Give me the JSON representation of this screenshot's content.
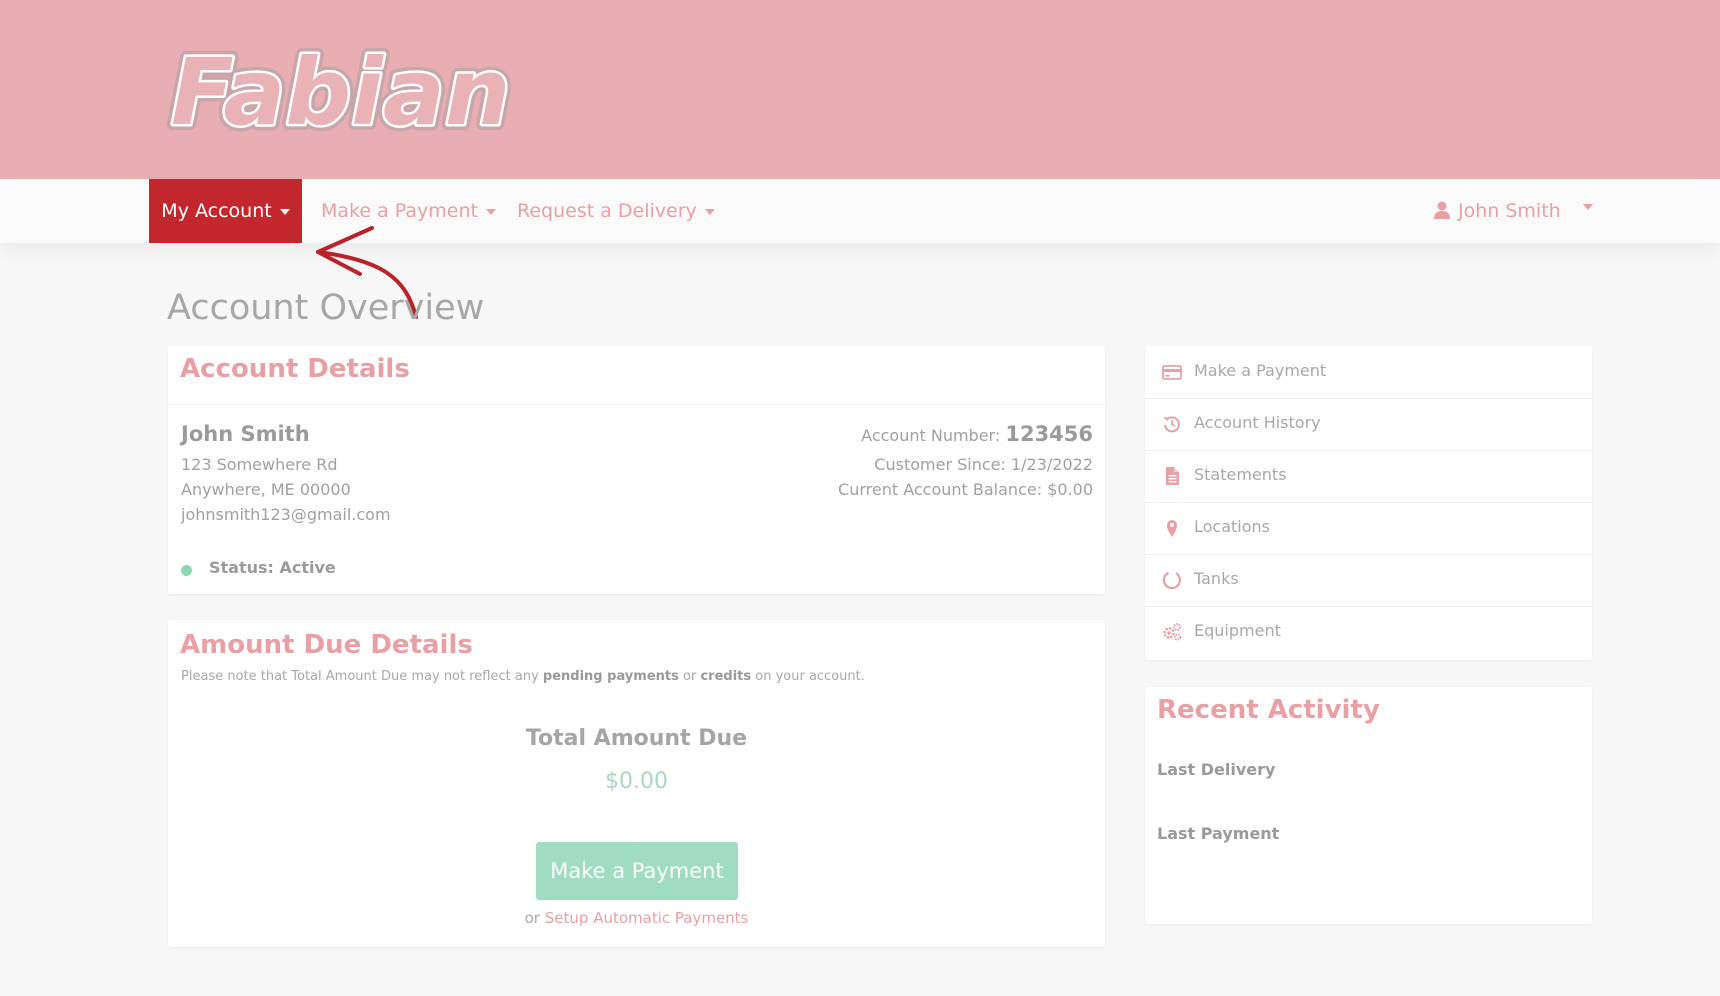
{
  "brand": {
    "logo_text": "Fabian"
  },
  "nav": {
    "my_account": "My Account",
    "make_payment": "Make a Payment",
    "request_delivery": "Request a Delivery",
    "user_name": "John Smith"
  },
  "page_title": "Account Overview",
  "account_details": {
    "title": "Account Details",
    "name": "John Smith",
    "address_line1": "123 Somewhere Rd",
    "address_line2": "Anywhere, ME 00000",
    "email": "johnsmith123@gmail.com",
    "account_number_label": "Account Number:",
    "account_number": "123456",
    "customer_since": "Customer Since: 1/23/2022",
    "balance": "Current Account Balance: $0.00",
    "status": "Status: Active"
  },
  "amount_due": {
    "title": "Amount Due Details",
    "note_prefix": "Please note that Total Amount Due may not reflect any",
    "note_bold1": "pending payments",
    "note_mid": "or",
    "note_bold2": "credits",
    "note_suffix": "on your account.",
    "total_label": "Total Amount Due",
    "total_value": "$0.00",
    "pay_button": "Make a Payment",
    "auto_prefix": "or",
    "auto_link": "Setup Automatic Payments"
  },
  "sidebar": {
    "items": [
      {
        "label": "Make a Payment",
        "icon": "credit-card-icon"
      },
      {
        "label": "Account History",
        "icon": "history-icon"
      },
      {
        "label": "Statements",
        "icon": "document-icon"
      },
      {
        "label": "Locations",
        "icon": "map-pin-icon"
      },
      {
        "label": "Tanks",
        "icon": "circle-icon"
      },
      {
        "label": "Equipment",
        "icon": "gears-icon"
      }
    ]
  },
  "recent_activity": {
    "title": "Recent Activity",
    "last_delivery": "Last Delivery",
    "last_payment": "Last Payment"
  },
  "colors": {
    "header": "#e8aeb3",
    "active_nav": "#c1272d",
    "accent": "#e8a0a5",
    "button": "#9fdcc0",
    "status_active": "#8dd9b4"
  }
}
